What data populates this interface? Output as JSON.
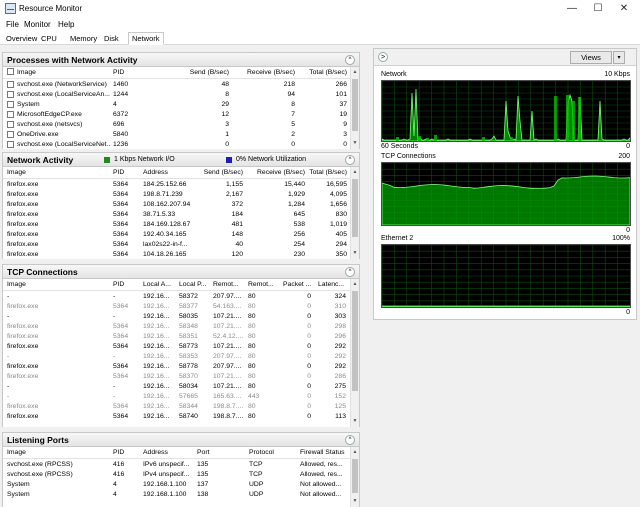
{
  "window": {
    "title": "Resource Monitor",
    "minimize": "—",
    "maximize": "☐",
    "close": "✕"
  },
  "menu": [
    "File",
    "Monitor",
    "Help"
  ],
  "tabs": [
    "Overview",
    "CPU",
    "Memory",
    "Disk",
    "Network"
  ],
  "processes": {
    "title": "Processes with Network Activity",
    "collapse_icon": "^",
    "columns": [
      "Image",
      "PID",
      "Send (B/sec)",
      "Receive (B/sec)",
      "Total (B/sec)"
    ],
    "rows": [
      [
        "svchost.exe (NetworkService)",
        "1460",
        "48",
        "218",
        "266"
      ],
      [
        "svchost.exe (LocalServiceAn...",
        "1244",
        "8",
        "94",
        "101"
      ],
      [
        "System",
        "4",
        "29",
        "8",
        "37"
      ],
      [
        "MicrosoftEdgeCP.exe",
        "6372",
        "12",
        "7",
        "19"
      ],
      [
        "svchost.exe (netsvcs)",
        "696",
        "3",
        "5",
        "9"
      ],
      [
        "OneDrive.exe",
        "5840",
        "1",
        "2",
        "3"
      ],
      [
        "svchost.exe (LocalServiceNet...",
        "1236",
        "0",
        "0",
        "0"
      ]
    ]
  },
  "network_activity": {
    "title": "Network Activity",
    "legend": [
      {
        "label": "1 Kbps Network I/O",
        "color": "#1f8a1f"
      },
      {
        "label": "0% Network Utilization",
        "color": "#1d1db8"
      }
    ],
    "collapse_icon": "^",
    "columns": [
      "Image",
      "PID",
      "Address",
      "Send (B/sec)",
      "Receive (B/sec)",
      "Total (B/sec)"
    ],
    "rows": [
      [
        "firefox.exe",
        "5364",
        "184.25.152.66",
        "1,155",
        "15,440",
        "16,595"
      ],
      [
        "firefox.exe",
        "5364",
        "198.8.71.239",
        "2,167",
        "1,929",
        "4,095"
      ],
      [
        "firefox.exe",
        "5364",
        "108.162.207.94",
        "372",
        "1,284",
        "1,656"
      ],
      [
        "firefox.exe",
        "5364",
        "38.71.5.33",
        "184",
        "645",
        "830"
      ],
      [
        "firefox.exe",
        "5364",
        "184.169.128.67",
        "481",
        "538",
        "1,019"
      ],
      [
        "firefox.exe",
        "5364",
        "192.40.34.165",
        "148",
        "256",
        "405"
      ],
      [
        "firefox.exe",
        "5364",
        "lax02s22-in-f...",
        "40",
        "254",
        "294"
      ],
      [
        "firefox.exe",
        "5364",
        "104.18.26.165",
        "120",
        "230",
        "350"
      ]
    ]
  },
  "tcp": {
    "title": "TCP Connections",
    "collapse_icon": "^",
    "columns": [
      "Image",
      "PID",
      "Local A...",
      "Local P...",
      "Remot...",
      "Remot...",
      "Packet ...",
      "Latenc..."
    ],
    "rows": [
      [
        "-",
        "-",
        "192.16...",
        "58372",
        "207.97....",
        "80",
        "0",
        "324",
        false
      ],
      [
        "firefox.exe",
        "5364",
        "192.16...",
        "58377",
        "54.163....",
        "80",
        "0",
        "310",
        true
      ],
      [
        "-",
        "-",
        "192.16...",
        "58035",
        "107.21....",
        "80",
        "0",
        "303",
        false
      ],
      [
        "firefox.exe",
        "5364",
        "192.16...",
        "58348",
        "107.21....",
        "80",
        "0",
        "298",
        true
      ],
      [
        "firefox.exe",
        "5364",
        "192.16...",
        "58351",
        "52.4.12....",
        "80",
        "0",
        "296",
        true
      ],
      [
        "firefox.exe",
        "5364",
        "192.16...",
        "58773",
        "107.21....",
        "80",
        "0",
        "292",
        false
      ],
      [
        "-",
        "-",
        "192.16...",
        "58353",
        "207.97....",
        "80",
        "0",
        "292",
        true
      ],
      [
        "firefox.exe",
        "5364",
        "192.16...",
        "58778",
        "207.97....",
        "80",
        "0",
        "292",
        false
      ],
      [
        "firefox.exe",
        "5364",
        "192.16...",
        "58370",
        "107.21....",
        "80",
        "0",
        "286",
        true
      ],
      [
        "-",
        "-",
        "192.16...",
        "58034",
        "107.21....",
        "80",
        "0",
        "275",
        false
      ],
      [
        "-",
        "-",
        "192.16...",
        "57665",
        "165.63....",
        "443",
        "0",
        "152",
        true
      ],
      [
        "firefox.exe",
        "5364",
        "192.16...",
        "58344",
        "198.8.7....",
        "80",
        "0",
        "125",
        true
      ],
      [
        "firefox.exe",
        "5364",
        "192.16...",
        "58740",
        "198.8.7....",
        "80",
        "0",
        "113",
        false
      ]
    ]
  },
  "listening": {
    "title": "Listening Ports",
    "collapse_icon": "^",
    "columns": [
      "Image",
      "PID",
      "Address",
      "Port",
      "Protocol",
      "Firewall Status"
    ],
    "rows": [
      [
        "svchost.exe (RPCSS)",
        "416",
        "IPv6 unspecif...",
        "135",
        "TCP",
        "Allowed, res..."
      ],
      [
        "svchost.exe (RPCSS)",
        "416",
        "IPv4 unspecif...",
        "135",
        "TCP",
        "Allowed, res..."
      ],
      [
        "System",
        "4",
        "192.168.1.100",
        "137",
        "UDP",
        "Not allowed..."
      ],
      [
        "System",
        "4",
        "192.168.1.100",
        "138",
        "UDP",
        "Not allowed..."
      ]
    ]
  },
  "right_panel": {
    "expand_icon": ">",
    "views_label": "Views",
    "views_dropdown_icon": "▾",
    "graphs": [
      {
        "title": "Network",
        "max_label": "10 Kbps",
        "footer_left": "60 Seconds",
        "footer_right": "0",
        "color": "#00c000"
      },
      {
        "title": "TCP Connections",
        "max_label": "200",
        "footer_left": "",
        "footer_right": "0",
        "color": "#00c000"
      },
      {
        "title": "Ethernet 2",
        "max_label": "100%",
        "footer_left": "",
        "footer_right": "0",
        "color": "#00c000"
      }
    ]
  }
}
